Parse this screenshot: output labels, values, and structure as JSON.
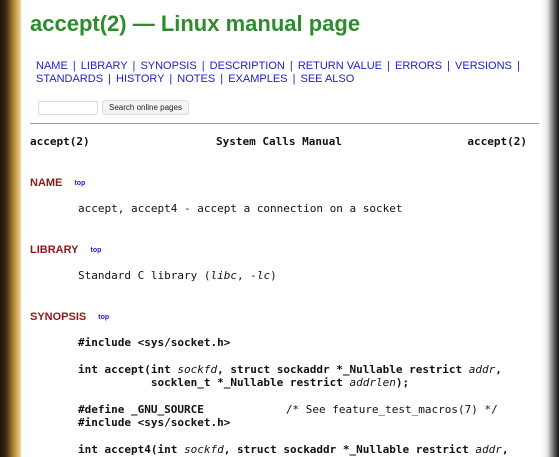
{
  "page": {
    "title": "accept(2) — Linux manual page"
  },
  "nav": {
    "items": [
      "NAME",
      "LIBRARY",
      "SYNOPSIS",
      "DESCRIPTION",
      "RETURN VALUE",
      "ERRORS",
      "VERSIONS",
      "STANDARDS",
      "HISTORY",
      "NOTES",
      "EXAMPLES",
      "SEE ALSO"
    ],
    "separator": "|"
  },
  "search": {
    "placeholder": "",
    "button_label": "Search online pages"
  },
  "manheader": {
    "left": "accept(2)",
    "center": "System Calls Manual",
    "right": "accept(2)"
  },
  "sections": {
    "name": {
      "heading": "NAME",
      "top": "top",
      "text": "accept, accept4 - accept a connection on a socket"
    },
    "library": {
      "heading": "LIBRARY",
      "top": "top",
      "prefix": "Standard C library (",
      "libc": "libc",
      "mid": ", ",
      "lc": "-lc",
      "suffix": ")"
    },
    "synopsis": {
      "heading": "SYNOPSIS",
      "top": "top",
      "include1": "#include <sys/socket.h>",
      "accept_l1_a": "int accept(int ",
      "accept_l1_sockfd": "sockfd",
      "accept_l1_b": ", struct sockaddr *_Nullable restrict ",
      "accept_l1_addr": "addr",
      "accept_l1_c": ",",
      "accept_l2_a": "           socklen_t *_Nullable restrict ",
      "accept_l2_addrlen": "addrlen",
      "accept_l2_b": ");",
      "define": "#define _GNU_SOURCE",
      "define_comment": "/* See feature_test_macros(7) */",
      "include2": "#include <sys/socket.h>",
      "accept4_a": "int accept4(int ",
      "accept4_sockfd": "sockfd",
      "accept4_b": ", struct sockaddr *_Nullable restrict ",
      "accept4_addr": "addr",
      "accept4_c": ","
    }
  }
}
